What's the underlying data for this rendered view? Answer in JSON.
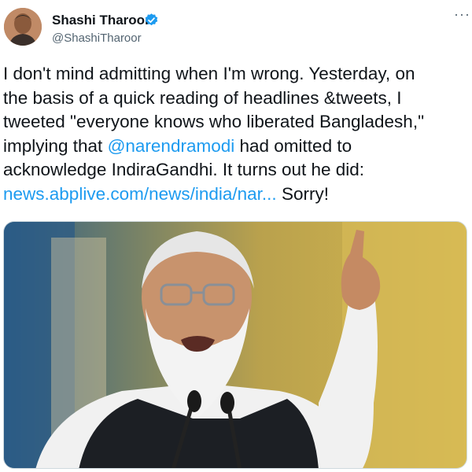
{
  "author": {
    "display_name": "Shashi Tharoor",
    "handle": "@ShashiTharoor",
    "verified_icon": "verified-badge-icon",
    "avatar_icon": "profile-photo"
  },
  "menu": {
    "more_label": "···",
    "icon": "more-options-icon"
  },
  "tweet": {
    "line1": "I don't mind admitting when I'm wrong. Yesterday, on",
    "line2": "the basis of a quick reading of headlines &tweets, I",
    "line3": "tweeted \"everyone knows who liberated Bangladesh,\"",
    "line4_pre": "implying that ",
    "mention": "@narendramodi",
    "line4_post": " had omitted to",
    "line5": "acknowledge IndiraGandhi. It turns out he did:",
    "url": "news.abplive.com/news/india/nar...",
    "url_suffix": " Sorry!"
  },
  "media": {
    "type": "photo"
  },
  "colors": {
    "link": "#1d9bf0",
    "verified": "#1d9bf0",
    "text": "#0f1419",
    "secondary": "#536471"
  }
}
